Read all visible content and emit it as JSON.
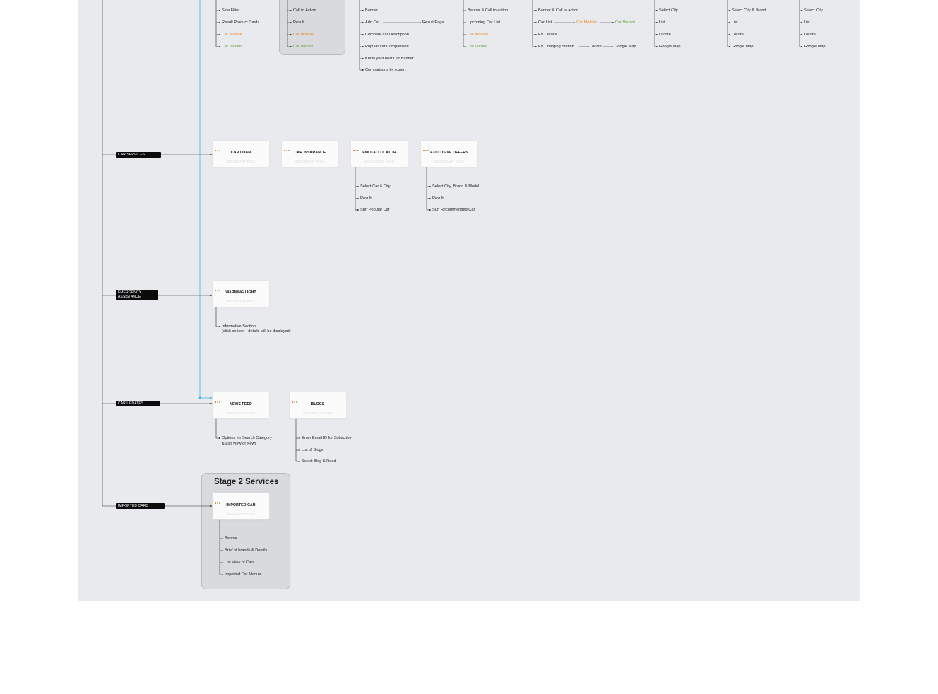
{
  "colors": {
    "canvas": "#e8eaed",
    "connector": "#2a2a2a",
    "highlight_connector": "#39b7e0",
    "dot_red": "#e2503f",
    "dot_yellow": "#f2b632",
    "dot_green": "#5fbb4a",
    "orange_text": "#e8892a",
    "green_text": "#5f9e2f"
  },
  "top_rows": {
    "col1": [
      "Side Filter",
      "Result Product Cards",
      "Car Module",
      "Car Variant"
    ],
    "col2": [
      "Call to Action",
      "Result",
      "Car Module",
      "Car Variant"
    ],
    "col3": [
      "Banner",
      "Add Car",
      "Compare car Description",
      "Popular car Comparision",
      "Know your best Car Banner",
      "Comparisons by expert"
    ],
    "col3_result": "Result Page",
    "col4": [
      "Banner & Call to action",
      "Upcoming Car List",
      "Car Module",
      "Car Variant"
    ],
    "col5": [
      "Banner & Call to action",
      "Car List",
      "EV Details",
      "EV Charging Station"
    ],
    "col5_module": "Car Module",
    "col5_variant": "Car Variant",
    "col5_locate": "Locate",
    "col5_map": "Google Map",
    "col6": [
      "Select City",
      "List",
      "Locate",
      "Google Map"
    ],
    "col7": [
      "Select City & Brand",
      "List",
      "Locate",
      "Google Map"
    ],
    "col8": [
      "Select City",
      "List",
      "Locate",
      "Google Map"
    ]
  },
  "sections": {
    "car_services": "CAR SERVICES",
    "emergency_1": "EMERGENCY",
    "emergency_2": "ASSISTANCE",
    "car_updates": "CAR UPDATES",
    "imported_cars": "IMPORTED CARS"
  },
  "nodes": {
    "car_loan": {
      "title": "CAR LOAN",
      "sub": "SECONDARY PAGE"
    },
    "car_insurance": {
      "title": "CAR INSURANCE",
      "sub": "SECONDARY PAGE"
    },
    "emi_calculator": {
      "title": "EMI CALCULATOR",
      "sub": "SECONDARY PAGE"
    },
    "exclusive_offers": {
      "title": "EXCLUSIVE OFFERS",
      "sub": "SECONDARY PAGE"
    },
    "warning_light": {
      "title": "WARNING LIGHT",
      "sub": "SECONDARY PAGE"
    },
    "news_feed": {
      "title": "NEWS FEED",
      "sub": "SECONDARY PAGE"
    },
    "blogs": {
      "title": "BLOGS",
      "sub": "SECONDARY PAGE"
    },
    "imported_car": {
      "title": "IMPORTED CAR",
      "sub": "SECONDARY PAGE"
    }
  },
  "leaves": {
    "emi": [
      "Select Car & City",
      "Result",
      "Surf Popular Car"
    ],
    "offers": [
      "Select City, Brand & Model",
      "Result",
      "Surf Recommended Car"
    ],
    "warning_1": "Informative Section",
    "warning_2": "(click on icon - details will be displayed)",
    "news_1": "Options for Search Category",
    "news_2": "& List View of News",
    "blogs": [
      "Enter Email ID for Subscribe",
      "List of Blogs",
      "Select Blog & Read"
    ],
    "imported": [
      "Banner",
      "Brief of brands & Details",
      "List View of Cars",
      "Imported Car Module"
    ]
  },
  "stage2": {
    "title": "Stage 2 Services"
  }
}
